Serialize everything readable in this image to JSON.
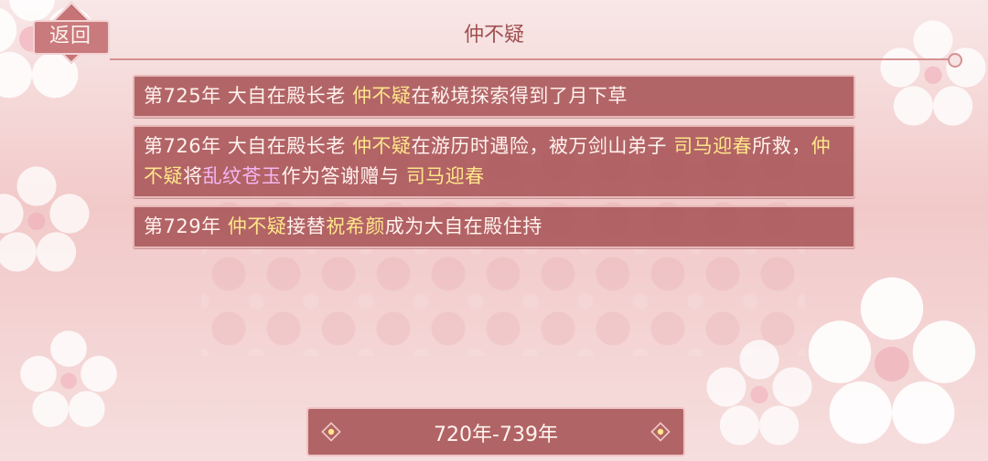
{
  "header": {
    "back_label": "返回",
    "title": "仲不疑"
  },
  "events": [
    {
      "parts": [
        {
          "text": "第725年 大自在殿长老 ",
          "color": "default"
        },
        {
          "text": "仲不疑",
          "color": "yellow"
        },
        {
          "text": "在秘境探索得到了月下草",
          "color": "default"
        }
      ]
    },
    {
      "parts": [
        {
          "text": "第726年 大自在殿长老 ",
          "color": "default"
        },
        {
          "text": "仲不疑",
          "color": "yellow"
        },
        {
          "text": "在游历时遇险，被万剑山弟子 ",
          "color": "default"
        },
        {
          "text": "司马迎春",
          "color": "yellow"
        },
        {
          "text": "所救，",
          "color": "default"
        },
        {
          "text": "仲不疑",
          "color": "yellow"
        },
        {
          "text": "将",
          "color": "default"
        },
        {
          "text": "乱纹苍玉",
          "color": "purple"
        },
        {
          "text": "作为答谢赠与 ",
          "color": "default"
        },
        {
          "text": "司马迎春",
          "color": "yellow"
        }
      ]
    },
    {
      "parts": [
        {
          "text": "第729年 ",
          "color": "default"
        },
        {
          "text": "仲不疑",
          "color": "yellow"
        },
        {
          "text": "接替",
          "color": "default"
        },
        {
          "text": "祝希颜",
          "color": "yellow"
        },
        {
          "text": "成为大自在殿住持",
          "color": "default"
        }
      ]
    }
  ],
  "range": {
    "label": "720年-739年"
  },
  "colors": {
    "panel": "#a85456",
    "highlight_name": "#ffe68a",
    "highlight_item": "#f4b6f2",
    "title": "#9f4f50"
  }
}
